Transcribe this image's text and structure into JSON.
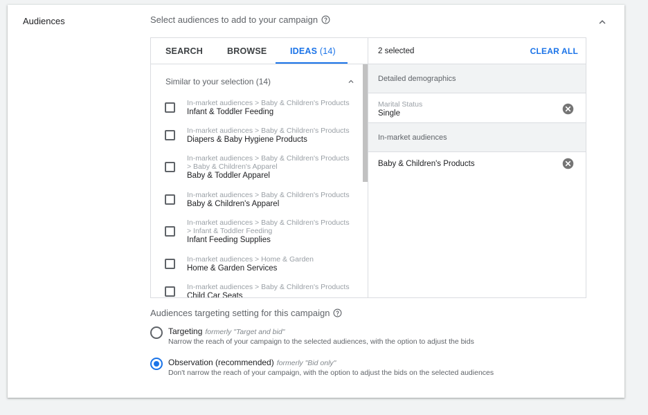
{
  "section": {
    "label": "Audiences",
    "intro": "Select audiences to add to your campaign"
  },
  "tabs": [
    {
      "label": "SEARCH"
    },
    {
      "label": "BROWSE"
    },
    {
      "label": "IDEAS",
      "count": "(14)"
    }
  ],
  "ideas": {
    "header": "Similar to your selection (14)",
    "items": [
      {
        "crumb1": "In-market audiences > Baby & Children's Products",
        "crumb2": "",
        "name": "Infant & Toddler Feeding"
      },
      {
        "crumb1": "In-market audiences > Baby & Children's Products",
        "crumb2": "",
        "name": "Diapers & Baby Hygiene Products"
      },
      {
        "crumb1": "In-market audiences > Baby & Children's Products",
        "crumb2": " > Baby & Children's Apparel",
        "name": "Baby & Toddler Apparel"
      },
      {
        "crumb1": "In-market audiences > Baby & Children's Products",
        "crumb2": "",
        "name": "Baby & Children's Apparel"
      },
      {
        "crumb1": "In-market audiences > Baby & Children's Products",
        "crumb2": " > Infant & Toddler Feeding",
        "name": "Infant Feeding Supplies"
      },
      {
        "crumb1": "In-market audiences > Home & Garden",
        "crumb2": "",
        "name": "Home & Garden Services"
      },
      {
        "crumb1": "In-market audiences > Baby & Children's Products",
        "crumb2": "",
        "name": "Child Car Seats"
      }
    ]
  },
  "selected": {
    "count": "2 selected",
    "clear_all": "CLEAR ALL",
    "groups": [
      {
        "header": "Detailed demographics",
        "items": [
          {
            "category": "Marital Status",
            "value": "Single"
          }
        ]
      },
      {
        "header": "In-market audiences",
        "items": [
          {
            "category": "",
            "value": "Baby & Children's Products"
          }
        ]
      }
    ]
  },
  "targeting": {
    "title": "Audiences targeting setting for this campaign",
    "options": [
      {
        "title": "Targeting",
        "formerly": "formerly \"Target and bid\"",
        "desc": "Narrow the reach of your campaign to the selected audiences, with the option to adjust the bids",
        "checked": false
      },
      {
        "title": "Observation (recommended)",
        "formerly": "formerly \"Bid only\"",
        "desc": "Don't narrow the reach of your campaign, with the option to adjust the bids on the selected audiences",
        "checked": true
      }
    ]
  },
  "colors": {
    "accent": "#1a73e8",
    "text": "#202124",
    "muted": "#5f6368"
  },
  "icons": {
    "help": "help-circle-icon",
    "collapse": "chevron-up-icon",
    "remove": "remove-circle-icon"
  }
}
